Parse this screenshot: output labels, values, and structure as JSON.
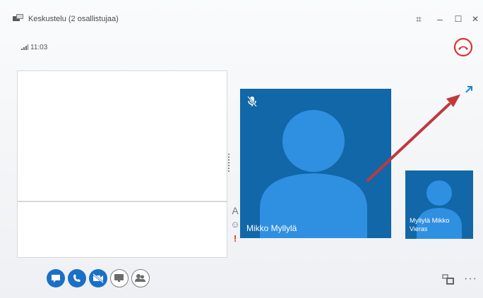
{
  "window": {
    "title": "Keskustelu (2 osallistujaa)",
    "controls": {
      "compact": "⌗",
      "minimize": "–",
      "maximize": "☐",
      "close": "✕"
    }
  },
  "status": {
    "time": "11:03"
  },
  "chat": {
    "tools": {
      "font": "A",
      "emoticon": "☺",
      "priority": "!"
    }
  },
  "participants": {
    "main": {
      "name": "Mikko Myllylä"
    },
    "self": {
      "name": "Myllylä Mikko",
      "role": "Vieras"
    }
  },
  "toolbar": {
    "buttons": [
      "chat-icon",
      "phone-icon",
      "video-off-icon",
      "present-icon",
      "participants-icon"
    ]
  },
  "colors": {
    "tile_blue": "#1167a8",
    "tile_silhouette": "#2f8fe0",
    "end_call_red": "#e03030",
    "arrow_red": "#c0393b",
    "accent_blue": "#1a6fc7"
  }
}
